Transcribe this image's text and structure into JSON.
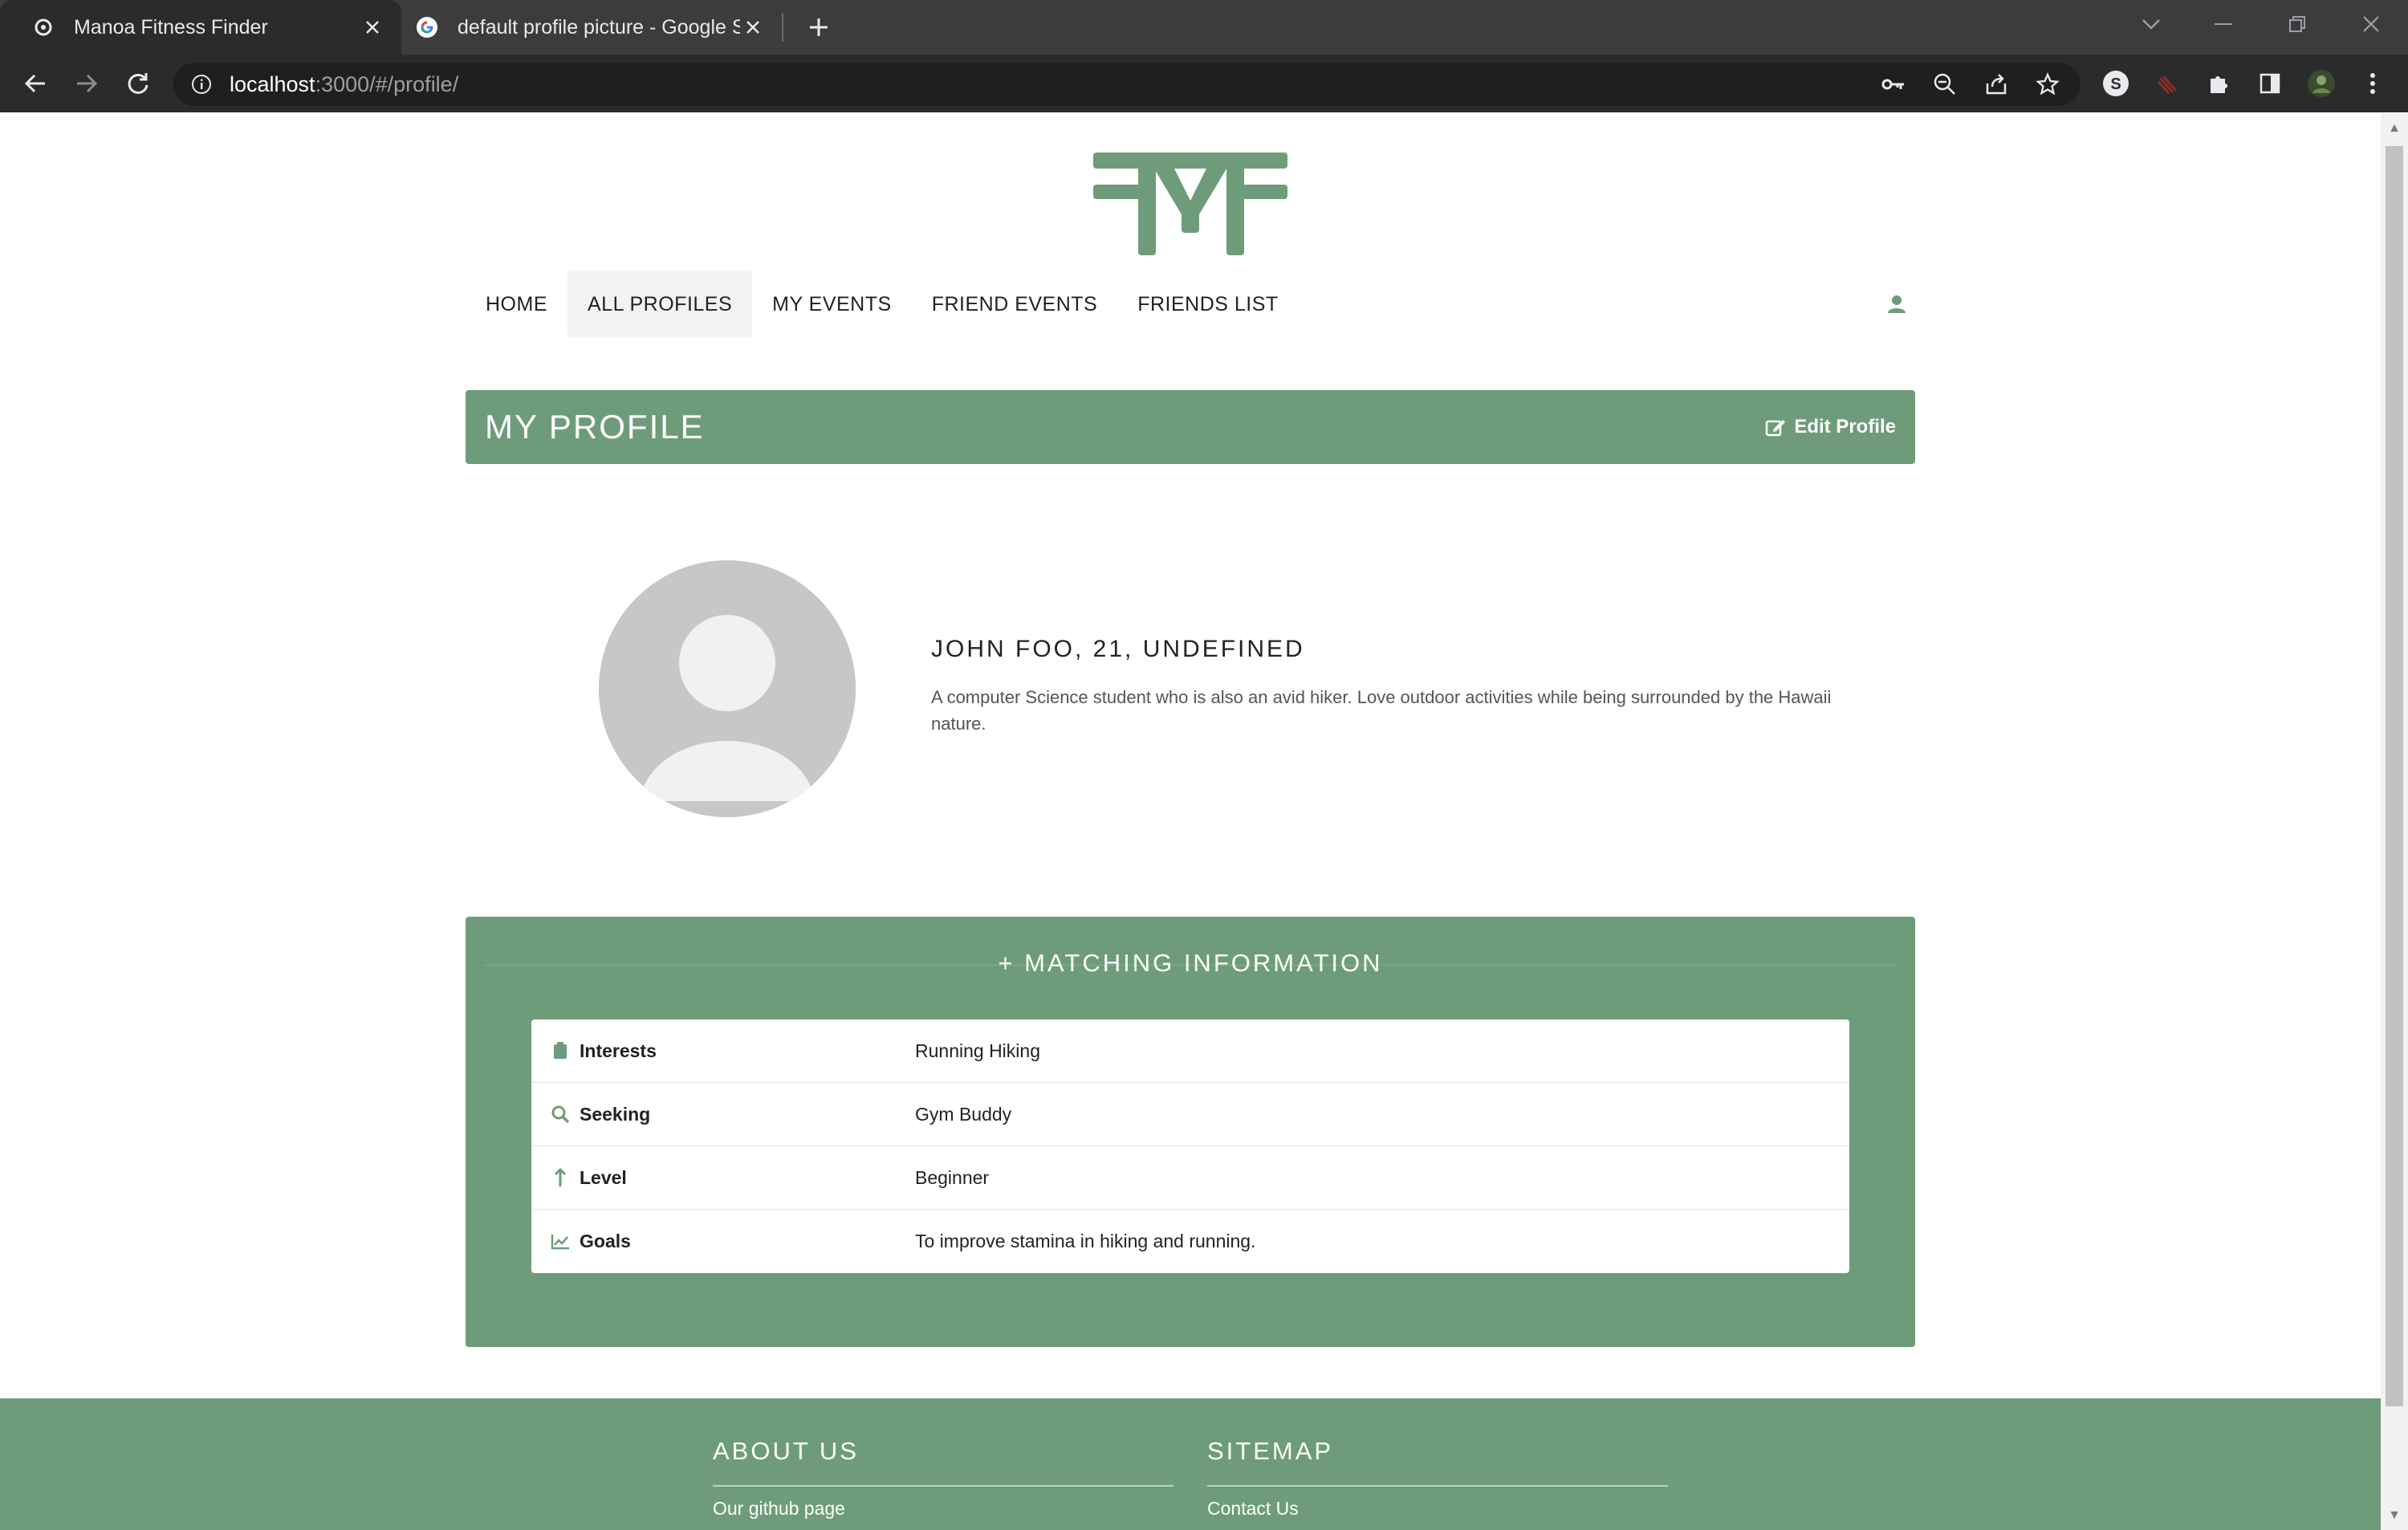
{
  "browser": {
    "tabs": [
      {
        "title": "Manoa Fitness Finder",
        "active": true,
        "favicon": "app-favicon-icon"
      },
      {
        "title": "default profile picture - Google S",
        "active": false,
        "favicon": "google-g-icon"
      }
    ],
    "url_host": "localhost",
    "url_path": ":3000/#/profile/"
  },
  "nav": {
    "items": [
      {
        "label": "HOME",
        "active": false
      },
      {
        "label": "ALL PROFILES",
        "active": true
      },
      {
        "label": "MY EVENTS",
        "active": false
      },
      {
        "label": "FRIEND EVENTS",
        "active": false
      },
      {
        "label": "FRIENDS LIST",
        "active": false
      }
    ]
  },
  "header": {
    "title": "MY PROFILE",
    "edit_label": "Edit Profile"
  },
  "profile": {
    "name_line": "JOHN FOO, 21, UNDEFINED",
    "bio": "A computer Science student who is also an avid hiker. Love outdoor activities while being surrounded by the Hawaii nature."
  },
  "matching": {
    "title": "+ MATCHING INFORMATION",
    "rows": [
      {
        "icon": "clipboard-icon",
        "label": "Interests",
        "value": "Running Hiking"
      },
      {
        "icon": "search-icon",
        "label": "Seeking",
        "value": "Gym Buddy"
      },
      {
        "icon": "arrow-up-icon",
        "label": "Level",
        "value": "Beginner"
      },
      {
        "icon": "line-chart-icon",
        "label": "Goals",
        "value": "To improve stamina in hiking and running."
      }
    ]
  },
  "footer": {
    "about": {
      "title": "ABOUT US",
      "link": "Our github page"
    },
    "sitemap": {
      "title": "SITEMAP",
      "link": "Contact Us"
    }
  },
  "colors": {
    "brand_green": "#6e9c7a",
    "chrome_dark": "#2b2b2b",
    "tabstrip": "#3c3c3c"
  }
}
